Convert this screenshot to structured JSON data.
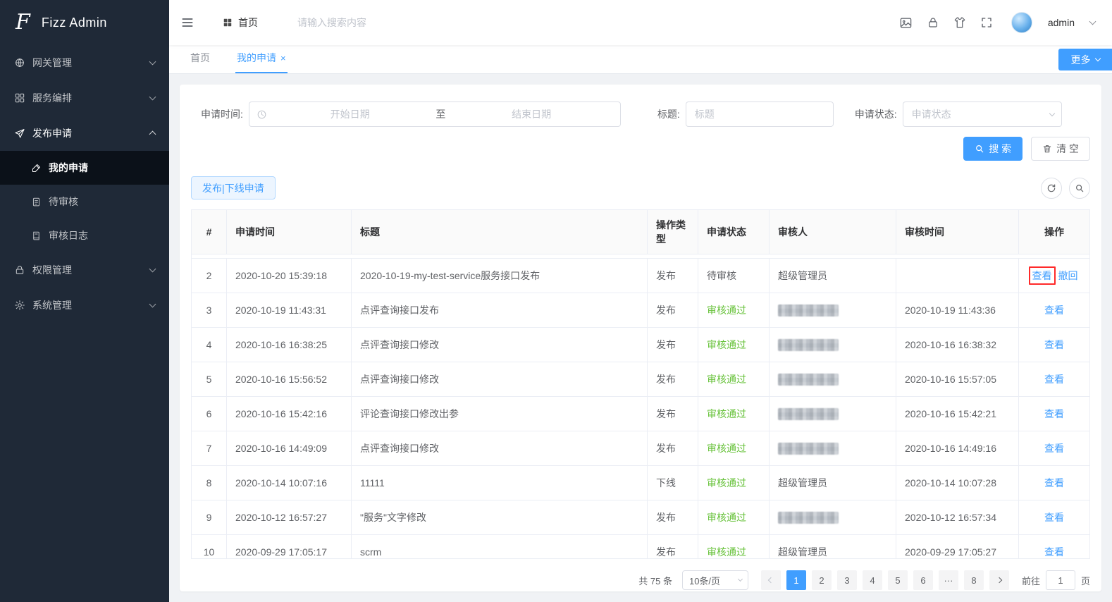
{
  "colors": {
    "accent": "#409eff",
    "success": "#67c23a",
    "highlight": "#ff2a2a"
  },
  "app": {
    "logo_letter": "F",
    "title": "Fizz Admin"
  },
  "sidebar": {
    "items": [
      {
        "label": "网关管理"
      },
      {
        "label": "服务编排"
      },
      {
        "label": "发布申请",
        "children": [
          {
            "label": "我的申请"
          },
          {
            "label": "待审核"
          },
          {
            "label": "审核日志"
          }
        ]
      },
      {
        "label": "权限管理"
      },
      {
        "label": "系统管理"
      }
    ]
  },
  "header": {
    "home_label": "首页",
    "search_placeholder": "请输入搜索内容",
    "username": "admin"
  },
  "tabs": {
    "items": [
      {
        "label": "首页"
      },
      {
        "label": "我的申请"
      }
    ],
    "more_button": "更多"
  },
  "icons": {
    "close_tab": "×"
  },
  "filters": {
    "time_label": "申请时间:",
    "start_placeholder": "开始日期",
    "range_separator": "至",
    "end_placeholder": "结束日期",
    "title_label": "标题:",
    "title_placeholder": "标题",
    "status_label": "申请状态:",
    "status_placeholder": "申请状态",
    "search_button": "搜 索",
    "clear_button": "清 空"
  },
  "toolbar": {
    "publish_button": "发布|下线申请"
  },
  "table": {
    "columns": [
      "#",
      "申请时间",
      "标题",
      "操作类型",
      "申请状态",
      "审核人",
      "审核时间",
      "操作"
    ],
    "rows": [
      {
        "index": "2",
        "apply_time": "2020-10-20 15:39:18",
        "title": "2020-10-19-my-test-service服务接口发布",
        "op_type": "发布",
        "status": "待审核",
        "status_type": "pending",
        "reviewer": "超级管理员",
        "reviewer_blurred": false,
        "review_time": "",
        "actions": [
          "查看",
          "撤回"
        ],
        "highlight_action": "查看"
      },
      {
        "index": "3",
        "apply_time": "2020-10-19 11:43:31",
        "title": "点评查询接口发布",
        "op_type": "发布",
        "status": "审核通过",
        "status_type": "success",
        "reviewer": "",
        "reviewer_blurred": true,
        "review_time": "2020-10-19 11:43:36",
        "actions": [
          "查看"
        ]
      },
      {
        "index": "4",
        "apply_time": "2020-10-16 16:38:25",
        "title": "点评查询接口修改",
        "op_type": "发布",
        "status": "审核通过",
        "status_type": "success",
        "reviewer": "",
        "reviewer_blurred": true,
        "review_time": "2020-10-16 16:38:32",
        "actions": [
          "查看"
        ]
      },
      {
        "index": "5",
        "apply_time": "2020-10-16 15:56:52",
        "title": "点评查询接口修改",
        "op_type": "发布",
        "status": "审核通过",
        "status_type": "success",
        "reviewer": "",
        "reviewer_blurred": true,
        "review_time": "2020-10-16 15:57:05",
        "actions": [
          "查看"
        ]
      },
      {
        "index": "6",
        "apply_time": "2020-10-16 15:42:16",
        "title": "评论查询接口修改出参",
        "op_type": "发布",
        "status": "审核通过",
        "status_type": "success",
        "reviewer": "",
        "reviewer_blurred": true,
        "review_time": "2020-10-16 15:42:21",
        "actions": [
          "查看"
        ]
      },
      {
        "index": "7",
        "apply_time": "2020-10-16 14:49:09",
        "title": "点评查询接口修改",
        "op_type": "发布",
        "status": "审核通过",
        "status_type": "success",
        "reviewer": "",
        "reviewer_blurred": true,
        "review_time": "2020-10-16 14:49:16",
        "actions": [
          "查看"
        ]
      },
      {
        "index": "8",
        "apply_time": "2020-10-14 10:07:16",
        "title": "11111",
        "op_type": "下线",
        "status": "审核通过",
        "status_type": "success",
        "reviewer": "超级管理员",
        "reviewer_blurred": false,
        "review_time": "2020-10-14 10:07:28",
        "actions": [
          "查看"
        ]
      },
      {
        "index": "9",
        "apply_time": "2020-10-12 16:57:27",
        "title": "\"服务\"文字修改",
        "op_type": "发布",
        "status": "审核通过",
        "status_type": "success",
        "reviewer": "",
        "reviewer_blurred": true,
        "review_time": "2020-10-12 16:57:34",
        "actions": [
          "查看"
        ]
      },
      {
        "index": "10",
        "apply_time": "2020-09-29 17:05:17",
        "title": "scrm",
        "op_type": "发布",
        "status": "审核通过",
        "status_type": "success",
        "reviewer": "超级管理员",
        "reviewer_blurred": false,
        "review_time": "2020-09-29 17:05:27",
        "actions": [
          "查看"
        ]
      }
    ]
  },
  "pagination": {
    "total_label": "共 75 条",
    "page_size": "10条/页",
    "pages": [
      "1",
      "2",
      "3",
      "4",
      "5",
      "6",
      "···",
      "8"
    ],
    "active_page": "1",
    "goto_label": "前往",
    "goto_value": "1",
    "goto_unit": "页"
  }
}
